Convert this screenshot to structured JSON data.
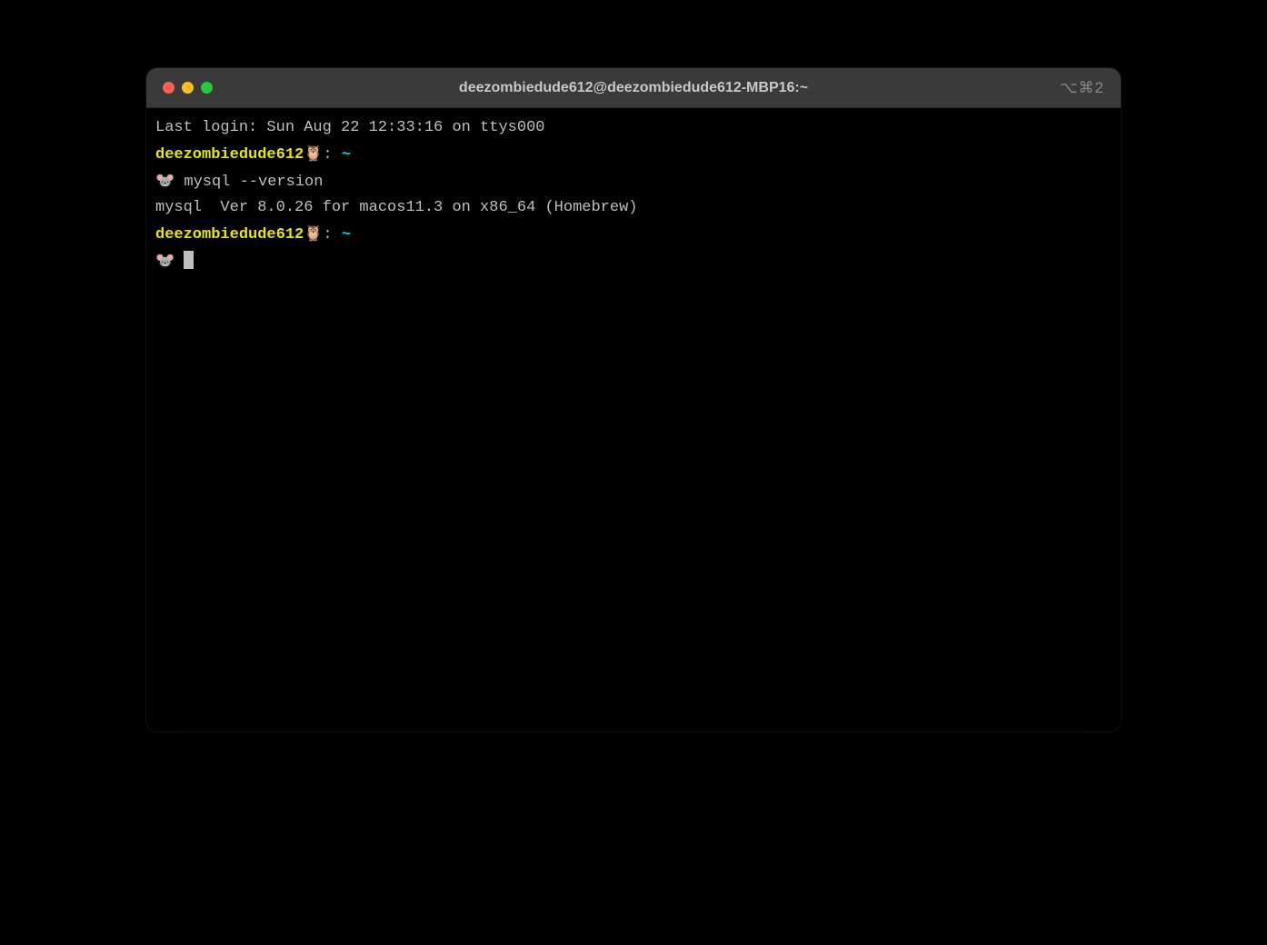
{
  "window": {
    "title": "deezombiedude612@deezombiedude612-MBP16:~",
    "titlebar_right": "⌥⌘2"
  },
  "terminal": {
    "last_login": "Last login: Sun Aug 22 12:33:16 on ttys000",
    "prompt_user": "deezombiedude612",
    "prompt_owl": "🦉",
    "prompt_colon": ":",
    "prompt_path": "~",
    "prompt_mouse": "🐭",
    "command1": "mysql --version",
    "output1": "mysql  Ver 8.0.26 for macos11.3 on x86_64 (Homebrew)"
  },
  "colors": {
    "background": "#000000",
    "titlebar": "#3a3a3a",
    "text": "#bfbfbf",
    "prompt_yellow": "#e6e600",
    "prompt_cyan": "#00d7d7",
    "traffic_red": "#ff5f56",
    "traffic_yellow": "#ffbd2e",
    "traffic_green": "#27c93f"
  }
}
